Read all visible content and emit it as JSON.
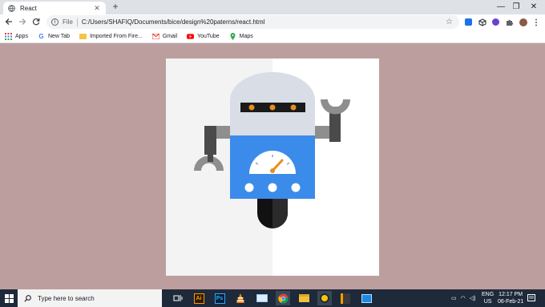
{
  "browser": {
    "tab_title": "React",
    "new_tab_symbol": "+",
    "tab_close_symbol": "✕",
    "window_controls": [
      "—",
      "❐",
      "✕"
    ],
    "address_scheme": "File",
    "address_url": "C:/Users/SHAFIQ/Documents/bice/design%20paterns/react.html",
    "bookmarks": [
      {
        "label": "Apps",
        "icon": "apps-grid-icon"
      },
      {
        "label": "New Tab",
        "icon": "google-icon"
      },
      {
        "label": "Imported From Fire...",
        "icon": "folder-icon"
      },
      {
        "label": "Gmail",
        "icon": "gmail-icon"
      },
      {
        "label": "YouTube",
        "icon": "youtube-icon"
      },
      {
        "label": "Maps",
        "icon": "maps-icon"
      }
    ]
  },
  "page": {
    "background_color": "#bd9e9e",
    "robot": {
      "head_color": "#d9dde6",
      "body_color": "#3b8beb",
      "visor_color": "#1a1a1a",
      "light_color": "#e88e1e",
      "arm_color": "#4a4a4a",
      "wheel_color": "#111111"
    }
  },
  "taskbar": {
    "search_placeholder": "Type here to search",
    "apps": [
      "task-view-icon",
      "illustrator-icon",
      "photoshop-icon",
      "vlc-icon",
      "mail-icon",
      "chrome-icon",
      "file-explorer-icon",
      "app-icon",
      "sublime-icon",
      "photos-icon"
    ],
    "language": "ENG",
    "region": "US",
    "time": "12:17 PM",
    "date": "06-Feb-21"
  }
}
